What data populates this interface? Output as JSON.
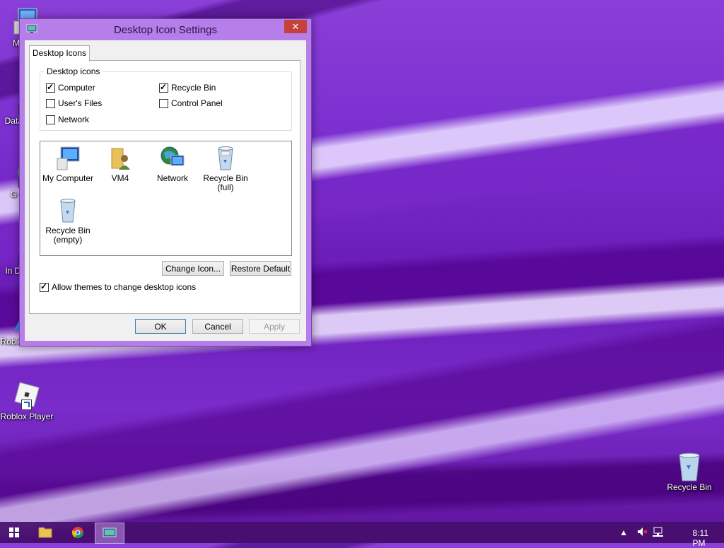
{
  "desktop": {
    "icons": [
      {
        "label": "My C",
        "name": "my-computer"
      },
      {
        "label": "Data",
        "name": "data"
      },
      {
        "label": "G C",
        "name": "google-chrome"
      },
      {
        "label": "In Do",
        "name": "internet-download"
      },
      {
        "label": "Roblox Studio",
        "name": "roblox-studio"
      },
      {
        "label": "Roblox Player",
        "name": "roblox-player"
      },
      {
        "label": "Recycle Bin",
        "name": "recycle-bin"
      }
    ]
  },
  "dialog": {
    "title": "Desktop Icon Settings",
    "close_symbol": "✕",
    "tab_label": "Desktop Icons",
    "group_label": "Desktop icons",
    "checkboxes": [
      {
        "label": "Computer",
        "checked": true
      },
      {
        "label": "Recycle Bin",
        "checked": true
      },
      {
        "label": "User's Files",
        "checked": false
      },
      {
        "label": "Control Panel",
        "checked": false
      },
      {
        "label": "Network",
        "checked": false
      }
    ],
    "icon_list": [
      {
        "line1": "My Computer",
        "line2": ""
      },
      {
        "line1": "VM4",
        "line2": ""
      },
      {
        "line1": "Network",
        "line2": ""
      },
      {
        "line1": "Recycle Bin",
        "line2": "(full)"
      },
      {
        "line1": "Recycle Bin",
        "line2": "(empty)"
      }
    ],
    "change_icon_label": "Change Icon...",
    "restore_default_label": "Restore Default",
    "allow_themes_label": "Allow themes to change desktop icons",
    "allow_themes_checked": true,
    "ok_label": "OK",
    "cancel_label": "Cancel",
    "apply_label": "Apply"
  },
  "taskbar": {
    "items": [
      "start-icon",
      "file-explorer-icon",
      "chrome-icon",
      "desktop-icon-settings-icon"
    ],
    "clock": "8:11 PM"
  }
}
